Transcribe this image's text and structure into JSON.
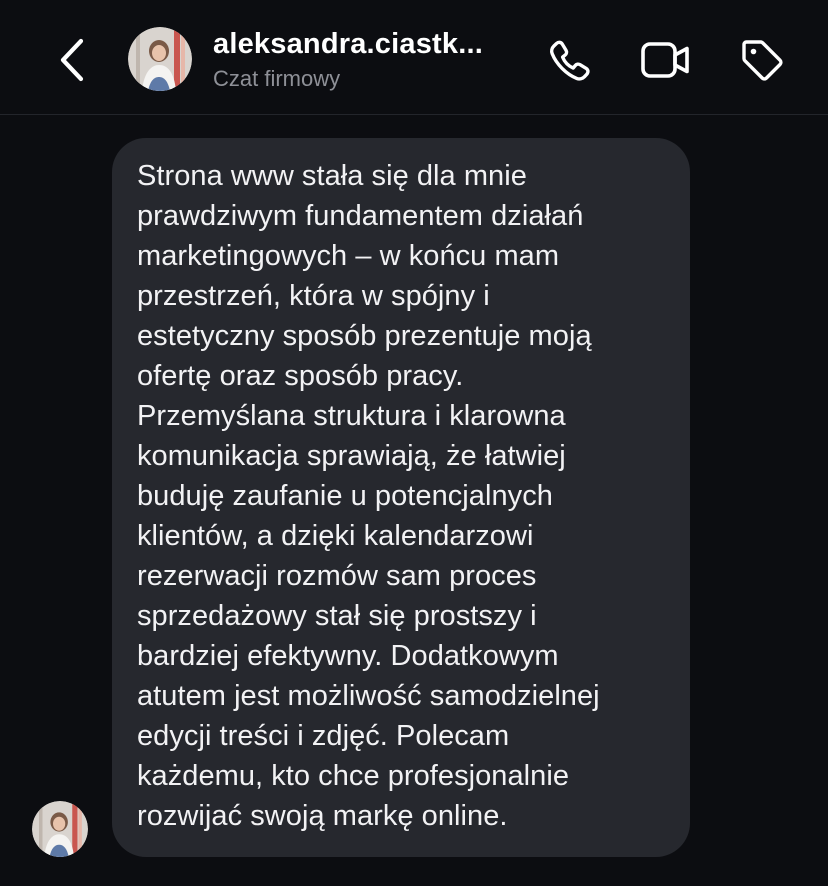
{
  "header": {
    "title": "aleksandra.ciastk...",
    "subtitle": "Czat firmowy",
    "back_icon": "chevron-left-icon",
    "call_icon": "phone-icon",
    "video_icon": "video-camera-icon",
    "label_icon": "tag-icon"
  },
  "message": {
    "text": "Strona www stała się dla mnie\nprawdziwym fundamentem działań\nmarketingowych – w końcu mam\nprzestrzeń, która w spójny i\nestetyczny sposób prezentuje moją\nofertę oraz sposób pracy.\nPrzemyślana struktura i klarowna\nkomunikacja sprawiają, że łatwiej\nbuduję zaufanie u potencjalnych\nklientów, a dzięki kalendarzowi\nrezerwacji rozmów sam proces\nsprzedażowy stał się prostszy i\nbardziej efektywny. Dodatkowym\natutem jest możliwość samodzielnej\nedycji treści i zdjęć. Polecam\nkażdemu, kto chce profesjonalnie\nrozwijać swoją markę online."
  },
  "colors": {
    "background": "#0c0d11",
    "bubble": "#26282e",
    "subtitle": "#8e9097",
    "text": "#ffffff"
  }
}
